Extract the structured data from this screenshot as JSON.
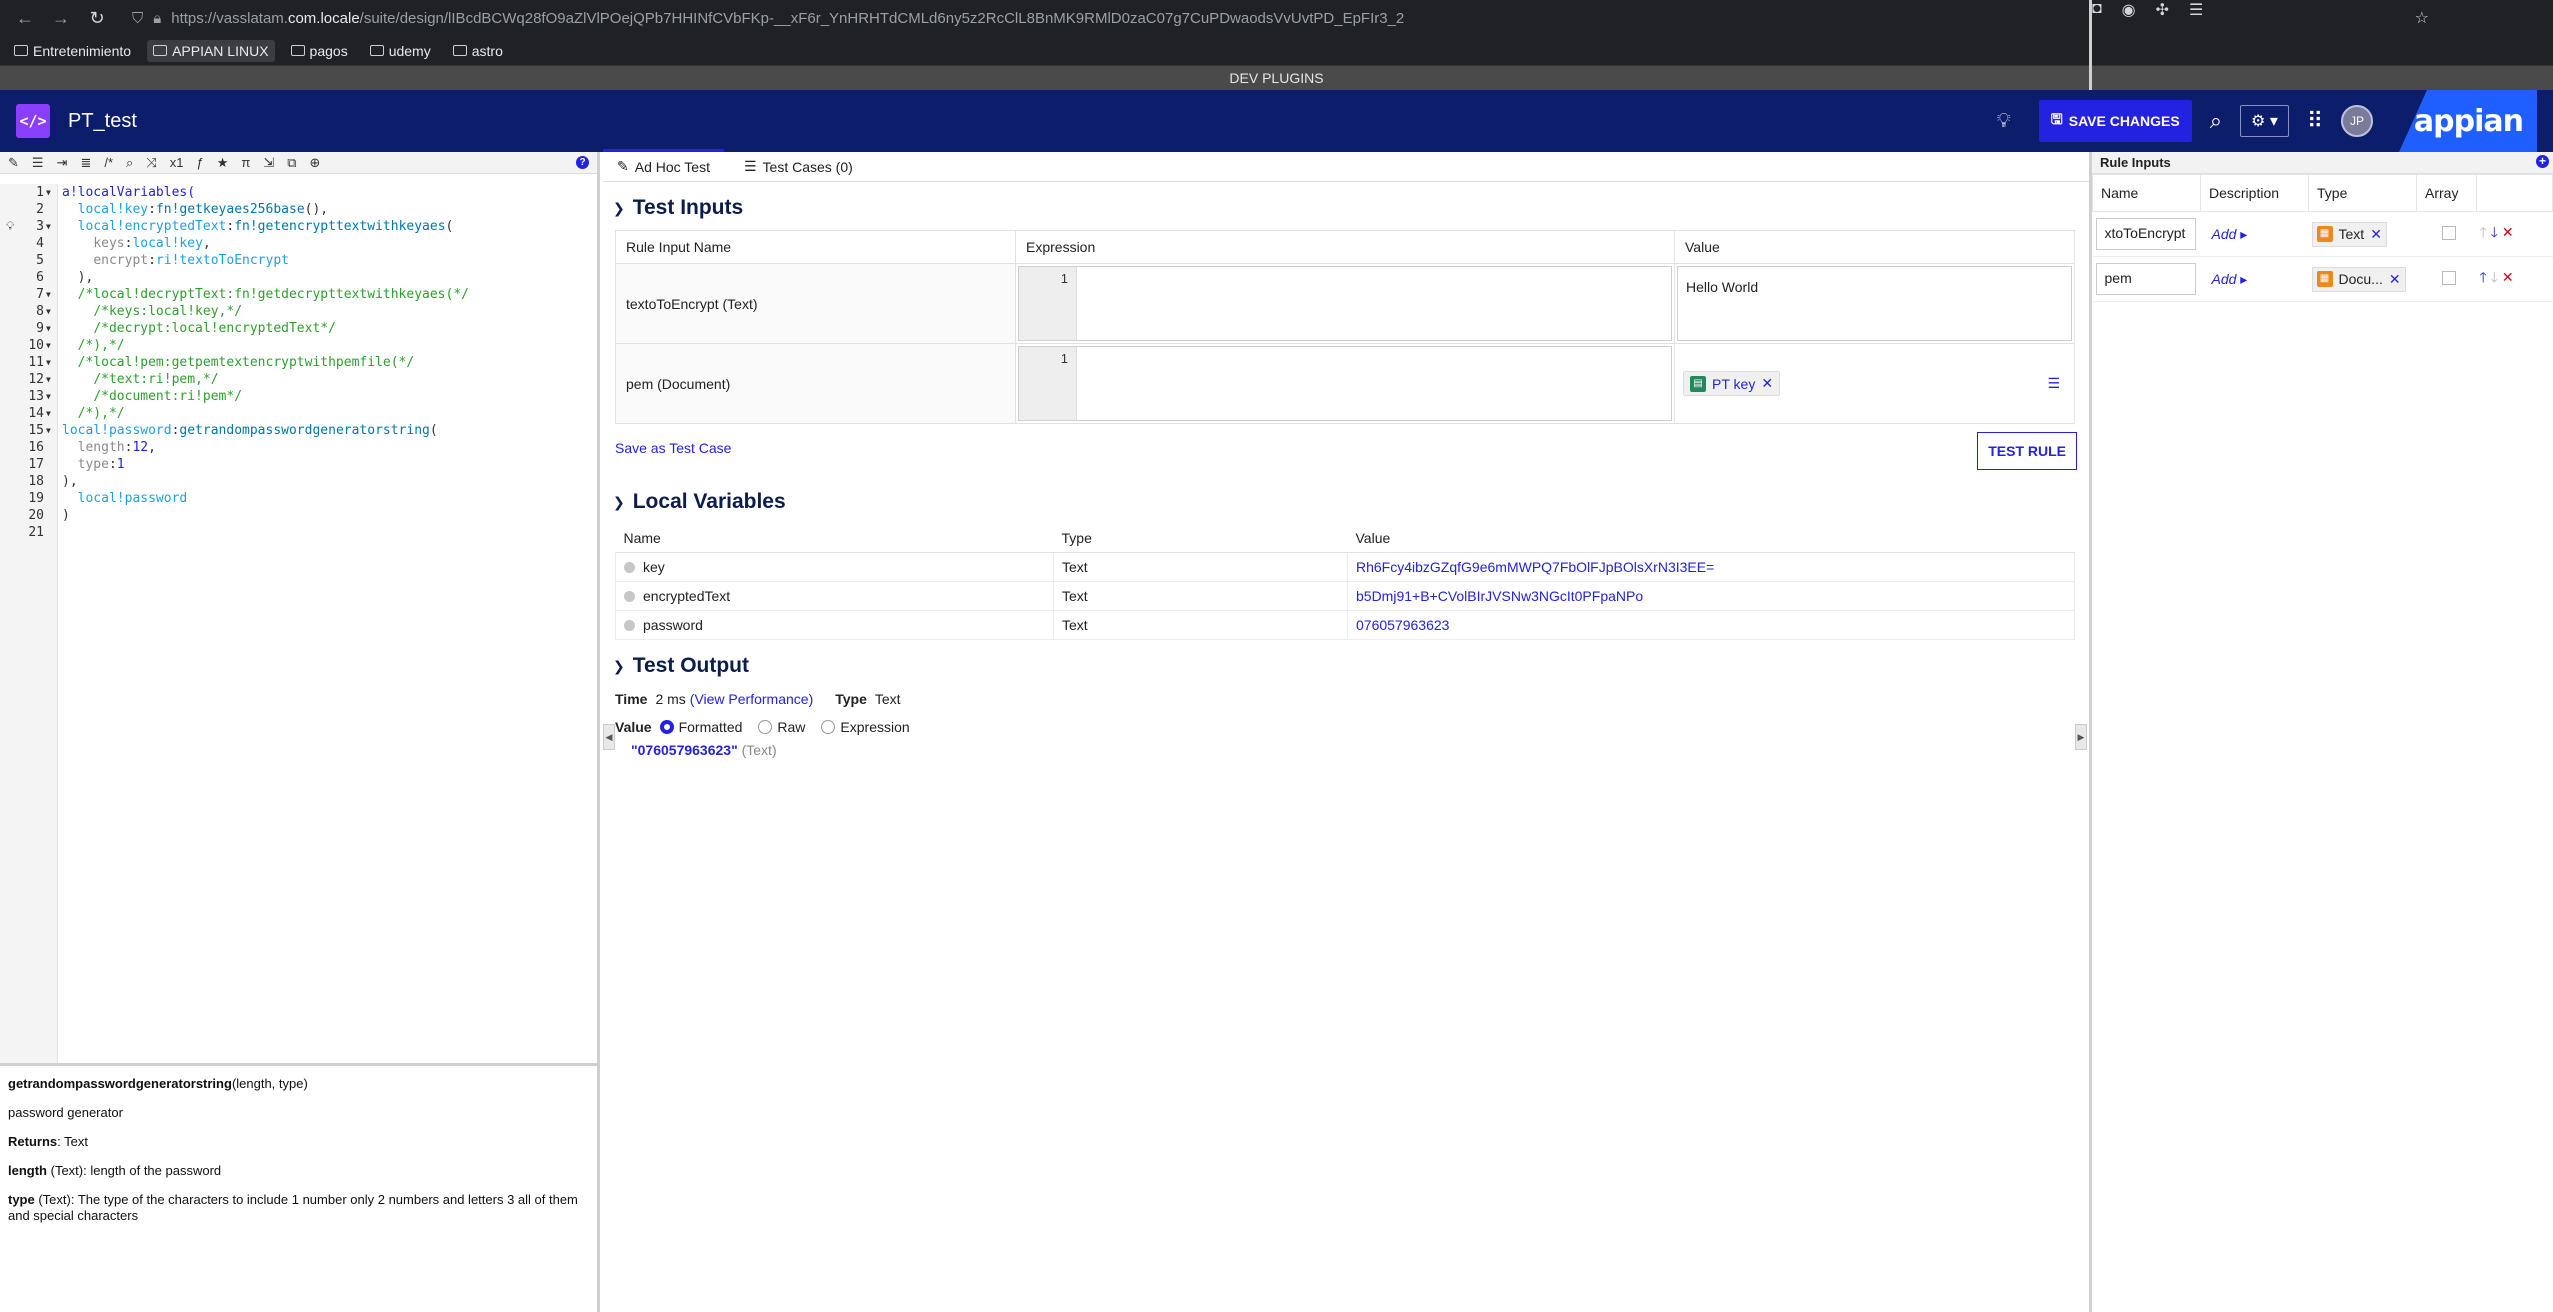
{
  "browser": {
    "url_prefix": "https://vasslatam.",
    "url_host": "com.locale",
    "url_path": "/suite/design/lIBcdBCWq28fO9aZlVlPOejQPb7HHINfCVbFKp-__xF6r_YnHRHTdCMLd6ny5z2RcClL8BnMK9RMlD0zaC07g7CuPDwaodsVvUvtPD_EpFIr3_2"
  },
  "bookmarks": [
    {
      "label": "Entretenimiento",
      "active": false
    },
    {
      "label": "APPIAN LINUX",
      "active": true
    },
    {
      "label": "pagos",
      "active": false
    },
    {
      "label": "udemy",
      "active": false
    },
    {
      "label": "astro",
      "active": false
    }
  ],
  "devbar": "DEV PLUGINS",
  "header": {
    "title": "PT_test",
    "save_label": "SAVE CHANGES",
    "avatar": "JP",
    "brand": "appian"
  },
  "code_lines": [
    {
      "n": "1",
      "fold": true,
      "parts": [
        [
          "kw",
          "a!localVariables("
        ]
      ]
    },
    {
      "n": "2",
      "fold": false,
      "parts": [
        [
          "plain",
          "  "
        ],
        [
          "var",
          "local!key"
        ],
        [
          "plain",
          ":"
        ],
        [
          "fn",
          "fn!getkeyaes256base"
        ],
        [
          "plain",
          "(),"
        ]
      ]
    },
    {
      "n": "3",
      "fold": true,
      "bulb": true,
      "parts": [
        [
          "plain",
          "  "
        ],
        [
          "var",
          "local!encryptedText"
        ],
        [
          "plain",
          ":"
        ],
        [
          "fn",
          "fn!getencrypttextwithkeyaes"
        ],
        [
          "plain",
          "("
        ]
      ]
    },
    {
      "n": "4",
      "fold": false,
      "parts": [
        [
          "plain",
          "    "
        ],
        [
          "key",
          "keys"
        ],
        [
          "plain",
          ":"
        ],
        [
          "var",
          "local!key"
        ],
        [
          "plain",
          ","
        ]
      ]
    },
    {
      "n": "5",
      "fold": false,
      "parts": [
        [
          "plain",
          "    "
        ],
        [
          "key",
          "encrypt"
        ],
        [
          "plain",
          ":"
        ],
        [
          "var",
          "ri!textoToEncrypt"
        ]
      ]
    },
    {
      "n": "6",
      "fold": false,
      "parts": [
        [
          "plain",
          "  ),"
        ]
      ]
    },
    {
      "n": "7",
      "fold": true,
      "parts": [
        [
          "plain",
          "  "
        ],
        [
          "cm",
          "/*local!decryptText:fn!getdecrypttextwithkeyaes(*/"
        ]
      ]
    },
    {
      "n": "8",
      "fold": true,
      "parts": [
        [
          "plain",
          "    "
        ],
        [
          "cm",
          "/*keys:local!key,*/"
        ]
      ]
    },
    {
      "n": "9",
      "fold": true,
      "parts": [
        [
          "plain",
          "    "
        ],
        [
          "cm",
          "/*decrypt:local!encryptedText*/"
        ]
      ]
    },
    {
      "n": "10",
      "fold": true,
      "parts": [
        [
          "plain",
          "  "
        ],
        [
          "cm",
          "/*),*/"
        ]
      ]
    },
    {
      "n": "11",
      "fold": true,
      "parts": [
        [
          "plain",
          "  "
        ],
        [
          "cm",
          "/*local!pem:getpemtextencryptwithpemfile(*/"
        ]
      ]
    },
    {
      "n": "12",
      "fold": true,
      "parts": [
        [
          "plain",
          "    "
        ],
        [
          "cm",
          "/*text:ri!pem,*/"
        ]
      ]
    },
    {
      "n": "13",
      "fold": true,
      "parts": [
        [
          "plain",
          "    "
        ],
        [
          "cm",
          "/*document:ri!pem*/"
        ]
      ]
    },
    {
      "n": "14",
      "fold": true,
      "parts": [
        [
          "plain",
          "  "
        ],
        [
          "cm",
          "/*),*/"
        ]
      ]
    },
    {
      "n": "15",
      "fold": true,
      "parts": [
        [
          "var",
          "local!password"
        ],
        [
          "plain",
          ":"
        ],
        [
          "fn",
          "getrandompasswordgeneratorstring"
        ],
        [
          "plain",
          "("
        ]
      ]
    },
    {
      "n": "16",
      "fold": false,
      "parts": [
        [
          "plain",
          "  "
        ],
        [
          "key",
          "length"
        ],
        [
          "plain",
          ":"
        ],
        [
          "num",
          "12"
        ],
        [
          "plain",
          ","
        ]
      ]
    },
    {
      "n": "17",
      "fold": false,
      "parts": [
        [
          "plain",
          "  "
        ],
        [
          "key",
          "type"
        ],
        [
          "plain",
          ":"
        ],
        [
          "num",
          "1"
        ]
      ]
    },
    {
      "n": "18",
      "fold": false,
      "parts": [
        [
          "plain",
          "),"
        ]
      ]
    },
    {
      "n": "19",
      "fold": false,
      "parts": [
        [
          "plain",
          "  "
        ],
        [
          "var",
          "local!password"
        ]
      ]
    },
    {
      "n": "20",
      "fold": false,
      "parts": [
        [
          "plain",
          ")"
        ]
      ]
    },
    {
      "n": "21",
      "fold": false,
      "parts": []
    }
  ],
  "doc": {
    "fn_name": "getrandompasswordgeneratorstring",
    "fn_sig": "(length, type)",
    "description": "password generator",
    "returns_label": "Returns",
    "returns_value": ": Text",
    "param1_name": "length",
    "param1_desc": " (Text): length of the password",
    "param2_name": "type",
    "param2_desc": " (Text): The type of the characters to include 1 number only 2 numbers and letters 3 all of them and special characters"
  },
  "tabs": {
    "adhoc": "Ad Hoc Test",
    "cases": "Test Cases (0)"
  },
  "test_inputs": {
    "title": "Test Inputs",
    "col_name": "Rule Input Name",
    "col_expr": "Expression",
    "col_value": "Value",
    "rows": [
      {
        "name": "textoToEncrypt (Text)",
        "line": "1",
        "value": "Hello World"
      },
      {
        "name": "pem (Document)",
        "line": "1",
        "value": "PT key"
      }
    ],
    "save_case": "Save as Test Case",
    "test_rule": "TEST RULE"
  },
  "local_vars": {
    "title": "Local Variables",
    "col_name": "Name",
    "col_type": "Type",
    "col_value": "Value",
    "rows": [
      {
        "name": "key",
        "type": "Text",
        "value": "Rh6Fcy4ibzGZqfG9e6mMWPQ7FbOlFJpBOlsXrN3I3EE="
      },
      {
        "name": "encryptedText",
        "type": "Text",
        "value": "b5Dmj91+B+CVolBIrJVSNw3NGcIt0PFpaNPo"
      },
      {
        "name": "password",
        "type": "Text",
        "value": "076057963623"
      }
    ]
  },
  "test_output": {
    "title": "Test Output",
    "time_label": "Time",
    "time_value": "2 ms",
    "view_perf": "(View Performance)",
    "type_label": "Type",
    "type_value": "Text",
    "value_label": "Value",
    "opt_formatted": "Formatted",
    "opt_raw": "Raw",
    "opt_expression": "Expression",
    "result": "\"076057963623\"",
    "result_type": "(Text)"
  },
  "rule_inputs": {
    "title": "Rule Inputs",
    "col_name": "Name",
    "col_desc": "Description",
    "col_type": "Type",
    "col_array": "Array",
    "add_label": "Add",
    "rows": [
      {
        "name": "xtoToEncrypt",
        "type": "Text"
      },
      {
        "name": "pem",
        "type": "Docu..."
      }
    ]
  },
  "colors": {
    "accent": "#2222e0",
    "header": "#0b1d6b",
    "brand": "#1f5fff",
    "logo": "#8a3ffc"
  }
}
